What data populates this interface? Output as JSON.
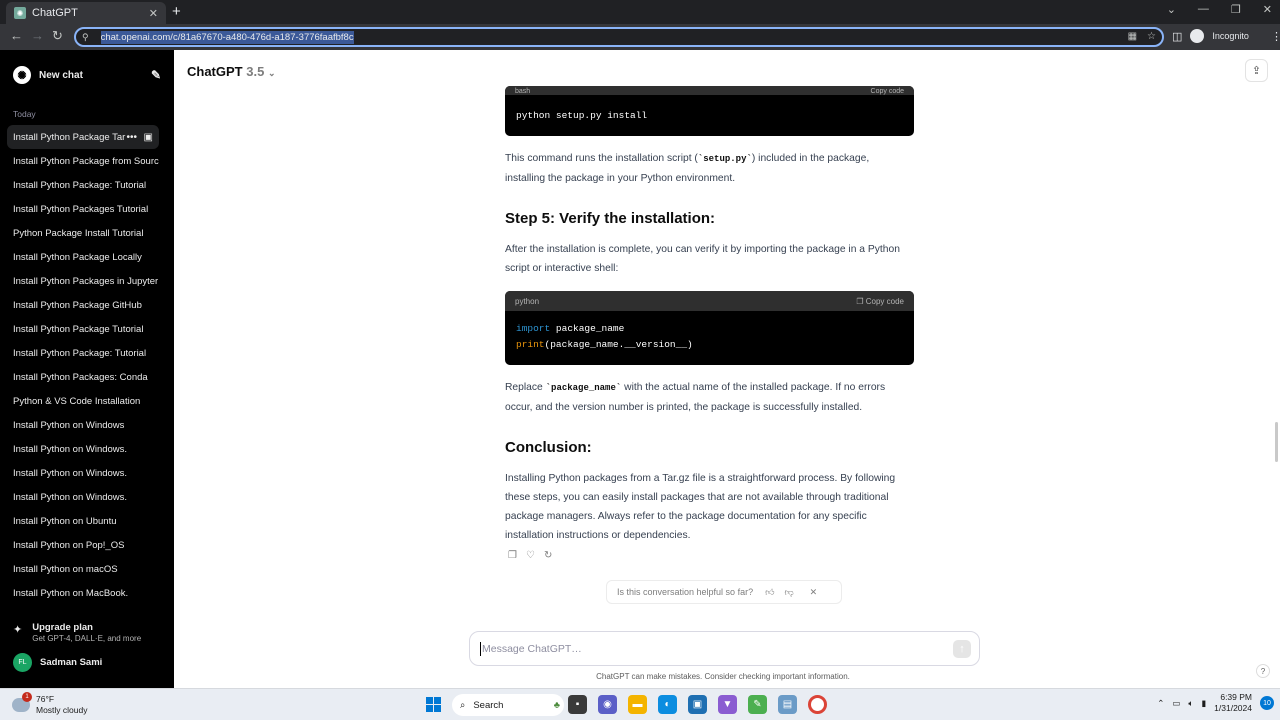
{
  "browser": {
    "tab_title": "ChatGPT",
    "tab_close": "✕",
    "new_tab": "+",
    "url": "chat.openai.com/c/81a67670-a480-476d-a187-3776faafbf8c",
    "profile_label": "Incognito"
  },
  "sidebar": {
    "new_chat": "New chat",
    "section": "Today",
    "conversations": [
      "Install Python Package Tar",
      "Install Python Package from Source",
      "Install Python Package: Tutorial",
      "Install Python Packages Tutorial",
      "Python Package Install Tutorial",
      "Install Python Package Locally",
      "Install Python Packages in Jupyter",
      "Install Python Package GitHub",
      "Install Python Package Tutorial",
      "Install Python Package: Tutorial",
      "Install Python Packages: Conda",
      "Python & VS Code Installation",
      "Install Python on Windows",
      "Install Python on Windows.",
      "Install Python on Windows.",
      "Install Python on Windows.",
      "Install Python on Ubuntu",
      "Install Python on Pop!_OS",
      "Install Python on macOS",
      "Install Python on MacBook."
    ],
    "upgrade_title": "Upgrade plan",
    "upgrade_sub": "Get GPT-4, DALL·E, and more",
    "user_initials": "FL",
    "user_name": "Sadman Sami"
  },
  "header": {
    "model": "ChatGPT",
    "version": "3.5"
  },
  "chat": {
    "code1_lang": "bash",
    "copy_label": "Copy code",
    "code1": "python setup.py install",
    "p1_a": "This command runs the installation script (",
    "p1_code": "`setup.py`",
    "p1_b": ") included in the package, installing the package in your Python environment.",
    "step5": "Step 5: Verify the installation:",
    "p2": "After the installation is complete, you can verify it by importing the package in a Python script or interactive shell:",
    "code2_lang": "python",
    "code2_kw": "import",
    "code2_line1": " package_name",
    "code2_fn": "print",
    "code2_line2": "(package_name.__version__)",
    "p3_a": "Replace ",
    "p3_code": "`package_name`",
    "p3_b": " with the actual name of the installed package. If no errors occur, and the version number is printed, the package is successfully installed.",
    "conclusion": "Conclusion:",
    "p4": "Installing Python packages from a Tar.gz file is a straightforward process. By following these steps, you can easily install packages that are not available through traditional package managers. Always refer to the package documentation for any specific installation instructions or dependencies."
  },
  "feedback": {
    "question": "Is this conversation helpful so far?"
  },
  "composer": {
    "placeholder": "Message ChatGPT…",
    "disclaimer": "ChatGPT can make mistakes. Consider checking important information.",
    "help": "?"
  },
  "taskbar": {
    "temp": "76°F",
    "condition": "Mostly cloudy",
    "weather_badge": "1",
    "search": "Search",
    "time": "6:39 PM",
    "date": "1/31/2024",
    "notifications": "10"
  }
}
